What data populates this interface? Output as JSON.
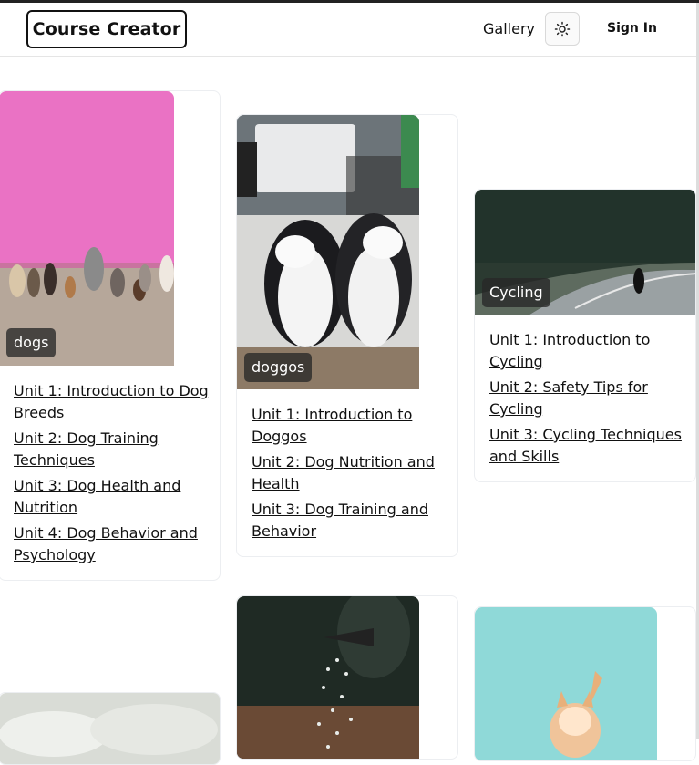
{
  "header": {
    "logo": "Course Creator",
    "nav_gallery": "Gallery",
    "sign_in": "Sign In",
    "theme_icon": "sun-icon"
  },
  "cards": [
    {
      "tag": "dogs",
      "units": [
        "Unit 1: Introduction to Dog Breeds",
        "Unit 2: Dog Training Techniques",
        "Unit 3: Dog Health and Nutrition",
        "Unit 4: Dog Behavior and Psychology"
      ]
    },
    {
      "tag": "doggos",
      "units": [
        "Unit 1: Introduction to Doggos",
        "Unit 2: Dog Nutrition and Health",
        "Unit 3: Dog Training and Behavior"
      ]
    },
    {
      "tag": "Cycling",
      "units": [
        "Unit 1: Introduction to Cycling",
        "Unit 2: Safety Tips for Cycling",
        "Unit 3: Cycling Techniques and Skills"
      ]
    }
  ],
  "colors": {
    "pink_wall": "#e96fc0",
    "teal_bg": "#8fd9d8",
    "forest": "#2d3d33"
  }
}
